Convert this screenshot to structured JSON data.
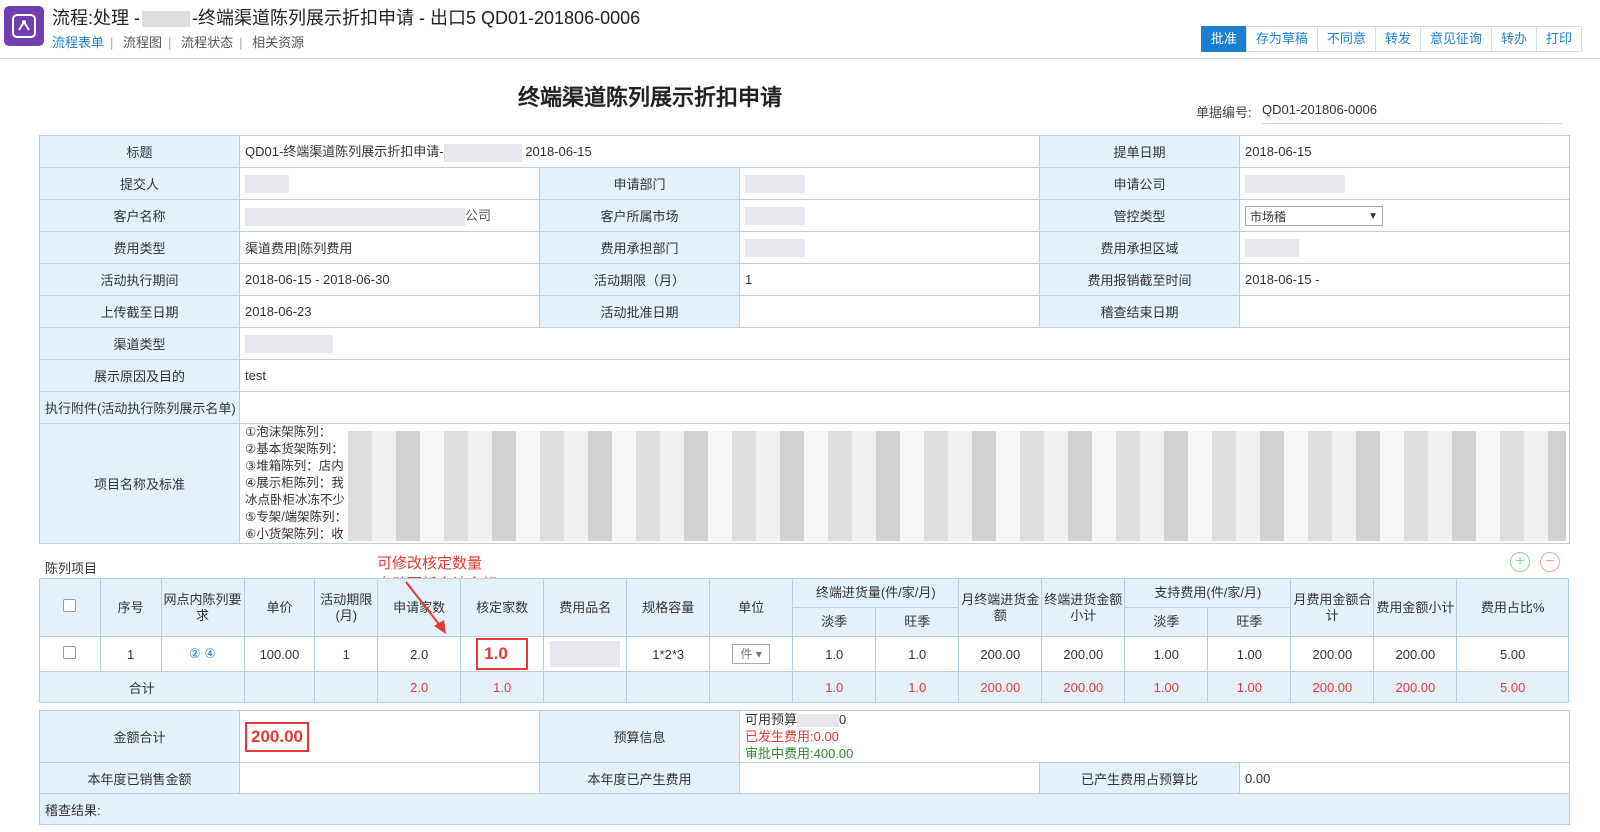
{
  "header": {
    "title_prefix": "流程:处理 -",
    "title_suffix": "-终端渠道陈列展示折扣申请 - 出口5 QD01-201806-0006",
    "tabs": [
      "流程表单",
      "流程图",
      "流程状态",
      "相关资源"
    ]
  },
  "toolbar": [
    "批准",
    "存为草稿",
    "不同意",
    "转发",
    "意见征询",
    "转办",
    "打印"
  ],
  "form": {
    "title": "终端渠道陈列展示折扣申请",
    "doc_no_label": "单据编号:",
    "doc_no": "QD01-201806-0006",
    "f_title_label": "标题",
    "f_title_value_a": "QD01-终端渠道陈列展示折扣申请-",
    "f_title_value_b": "2018-06-15",
    "submit_date_label": "提单日期",
    "submit_date": "2018-06-15",
    "submitter_label": "提交人",
    "dept_label": "申请部门",
    "company_label": "申请公司",
    "customer_label": "客户名称",
    "customer_suffix": "公司",
    "market_label": "客户所属市场",
    "control_label": "管控类型",
    "control_value": "市场稽",
    "fee_type_label": "费用类型",
    "fee_type": "渠道费用|陈列费用",
    "fee_dept_label": "费用承担部门",
    "fee_region_label": "费用承担区域",
    "exec_period_label": "活动执行期间",
    "exec_period": "2018-06-15 - 2018-06-30",
    "term_label": "活动期限（月）",
    "term": "1",
    "reimb_label": "费用报销截至时间",
    "reimb": "2018-06-15 -",
    "upload_label": "上传截至日期",
    "upload": "2018-06-23",
    "approve_date_label": "活动批准日期",
    "audit_end_label": "稽查结束日期",
    "channel_label": "渠道类型",
    "reason_label": "展示原因及目的",
    "reason": "test",
    "attach_label": "执行附件(活动执行陈列展示名单)",
    "items_label": "项目名称及标准",
    "items": [
      "①泡沫架陈列：",
      "②基本货架陈列：",
      "③堆箱陈列：店内",
      "④展示柜陈列：我",
      "冰点卧柜冰冻不少",
      "⑤专架/端架陈列：",
      "⑥小货架陈列：收"
    ]
  },
  "display": {
    "section_label": "陈列项目",
    "note": [
      "可修改核定数量",
      "自动更新合计金额"
    ],
    "headers": {
      "seq": "序号",
      "req": "网点内陈列要求",
      "price": "单价",
      "term": "活动期限(月)",
      "apply": "申请家数",
      "approved": "核定家数",
      "product": "费用品名",
      "spec": "规格容量",
      "unit": "单位",
      "term_purchase": "终端进货量(件/家/月)",
      "low": "淡季",
      "peak": "旺季",
      "month_amt": "月终端进货金额",
      "amt_sub": "终端进货金额小计",
      "support": "支持费用(件/家/月)",
      "low2": "淡季",
      "peak2": "旺季",
      "fee_month": "月费用金额合计",
      "fee_sub": "费用金额小计",
      "ratio": "费用占比%"
    },
    "row": {
      "seq": "1",
      "req": "② ④",
      "price": "100.00",
      "term": "1",
      "apply": "2.0",
      "approved": "1.0",
      "spec": "1*2*3",
      "unit": "件",
      "low": "1.0",
      "peak": "1.0",
      "month_amt": "200.00",
      "amt_sub": "200.00",
      "low2": "1.00",
      "peak2": "1.00",
      "fee_month": "200.00",
      "fee_sub": "200.00",
      "ratio": "5.00"
    },
    "sum": {
      "label": "合计",
      "apply": "2.0",
      "approved": "1.0",
      "low": "1.0",
      "peak": "1.0",
      "month_amt": "200.00",
      "amt_sub": "200.00",
      "low2": "1.00",
      "peak2": "1.00",
      "fee_month": "200.00",
      "fee_sub": "200.00",
      "ratio": "5.00"
    }
  },
  "bottom": {
    "total_label": "金额合计",
    "total": "200.00",
    "budget_label": "预算信息",
    "budget_avail": "可用预算",
    "budget_avail_tail": "0",
    "budget_used": "已发生费用:0.00",
    "budget_pending": "审批中费用:400.00",
    "sales_label": "本年度已销售金额",
    "year_fee_label": "本年度已产生费用",
    "ratio_label": "已产生费用占预算比",
    "ratio": "0.00",
    "audit_label": "稽查结果:"
  },
  "colors": {
    "accent": "#1b7fcf",
    "label_bg": "#e4f0fa",
    "highlight": "#e53935",
    "logo": "#6f3fb0"
  }
}
